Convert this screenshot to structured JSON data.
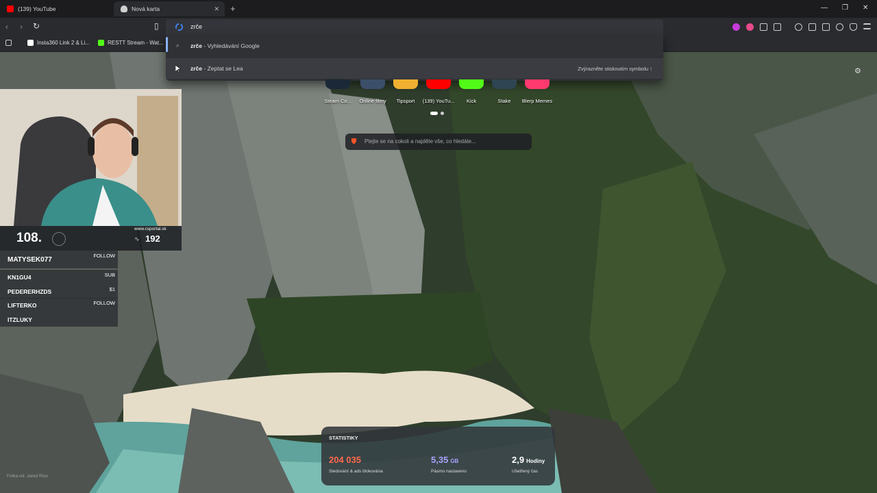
{
  "tabs": [
    {
      "label": "(139) YouTube",
      "favicon_color": "#ff0000"
    },
    {
      "label": "Nová karta",
      "favicon_color": "#cfcfcf",
      "active": true
    }
  ],
  "omnibox": {
    "query": "zrče"
  },
  "bookmarks": [
    {
      "label": "Insta360 Link 2 & Li...",
      "icon_color": "#ffffff"
    },
    {
      "label": "RESTT Stream - Wat...",
      "icon_color": "#53fc18"
    }
  ],
  "suggestions": [
    {
      "query": "zrče",
      "suffix": " - Vyhledávání Google",
      "icon": "search-icon"
    },
    {
      "query": "zrče",
      "suffix": " - Zeptat se Lea",
      "hint": "Zvýrazněte stisknutím symbolu ↑",
      "icon": "leo-icon"
    }
  ],
  "speed_dial": [
    {
      "label": "Steam Co...",
      "color": "#1b2838"
    },
    {
      "label": "Online filmy",
      "color": "#3b4f6b"
    },
    {
      "label": "Tipsport",
      "color": "#f0b030"
    },
    {
      "label": "(139) YouTu...",
      "color": "#ff0000"
    },
    {
      "label": "Kick",
      "color": "#53fc18"
    },
    {
      "label": "Stake",
      "color": "#2f4553"
    },
    {
      "label": "Blerp Memes",
      "color": "#ff3a6e"
    }
  ],
  "leo_search": {
    "placeholder": "Ptejte se na cokoli a najděte vše, co hledáte..."
  },
  "stats": {
    "title": "STATISTIKY",
    "items": [
      {
        "value": "204 035",
        "unit": "",
        "desc": "Sledování & ads blokována",
        "color": "#ff6a4d"
      },
      {
        "value": "5,35",
        "unit": "GB",
        "desc": "Pásmo nastaveno",
        "color": "#a7a4ff"
      },
      {
        "value": "2,9",
        "unit": "Hodiny",
        "desc": "Ušetřený čas",
        "color": "#ffffff"
      }
    ]
  },
  "overlay": {
    "rank": "108.",
    "site": "www.csportal.sk",
    "viewers": "192",
    "feed": [
      {
        "name": "MATYSEK077",
        "tag": "FOLLOW"
      },
      {
        "name": "KN1GU4",
        "tag": "SUB"
      },
      {
        "name": "PEDERERHZDS",
        "tag": "$1"
      },
      {
        "name": "LIFTERKO",
        "tag": "FOLLOW"
      },
      {
        "name": "ITZLUKY",
        "tag": ""
      }
    ]
  },
  "photo_credit": "Fotka od: Jared Rice"
}
